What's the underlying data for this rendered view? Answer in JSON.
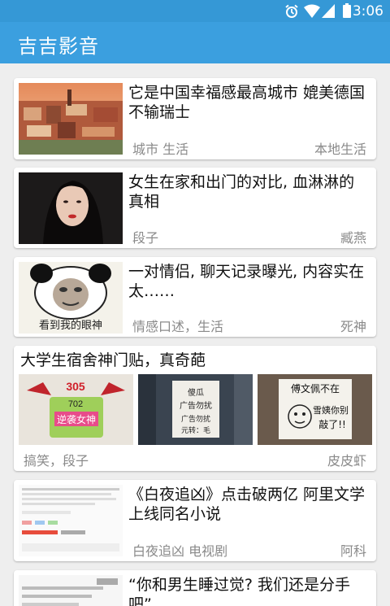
{
  "status_bar": {
    "time": "3:06"
  },
  "app": {
    "title": "吉吉影音"
  },
  "feed": [
    {
      "title": "它是中国幸福感最高城市 媲美德国不输瑞士",
      "category": "城市 生活",
      "source": "本地生活"
    },
    {
      "title": "女生在家和出门的对比, 血淋淋的真相",
      "category": "段子",
      "source": "臧燕"
    },
    {
      "title": "一对情侣, 聊天记录曝光, 内容实在太……",
      "category": "情感口述，生活",
      "source": "死神",
      "thumb_caption": "看到我的眼神"
    },
    {
      "title": "大学生宿舍神门贴，真奇葩",
      "category": "搞笑，段子",
      "source": "皮皮虾",
      "gallery_text": [
        "305",
        "702",
        "逆袭女神",
        "傻瓜",
        "广告勿扰",
        "广告勿扰",
        "元转：毛",
        "傅文佩不在",
        "雪姨你别",
        "敲了!!"
      ]
    },
    {
      "title": "《白夜追凶》点击破两亿 阿里文学上线同名小说",
      "category": "白夜追凶 电视剧",
      "source": "阿科"
    },
    {
      "title": "“你和男生睡过觉? 我们还是分手吧”"
    }
  ],
  "colors": {
    "status_bar": "#3598d6",
    "app_bar": "#3b9fdf",
    "background": "#eeeeee"
  }
}
